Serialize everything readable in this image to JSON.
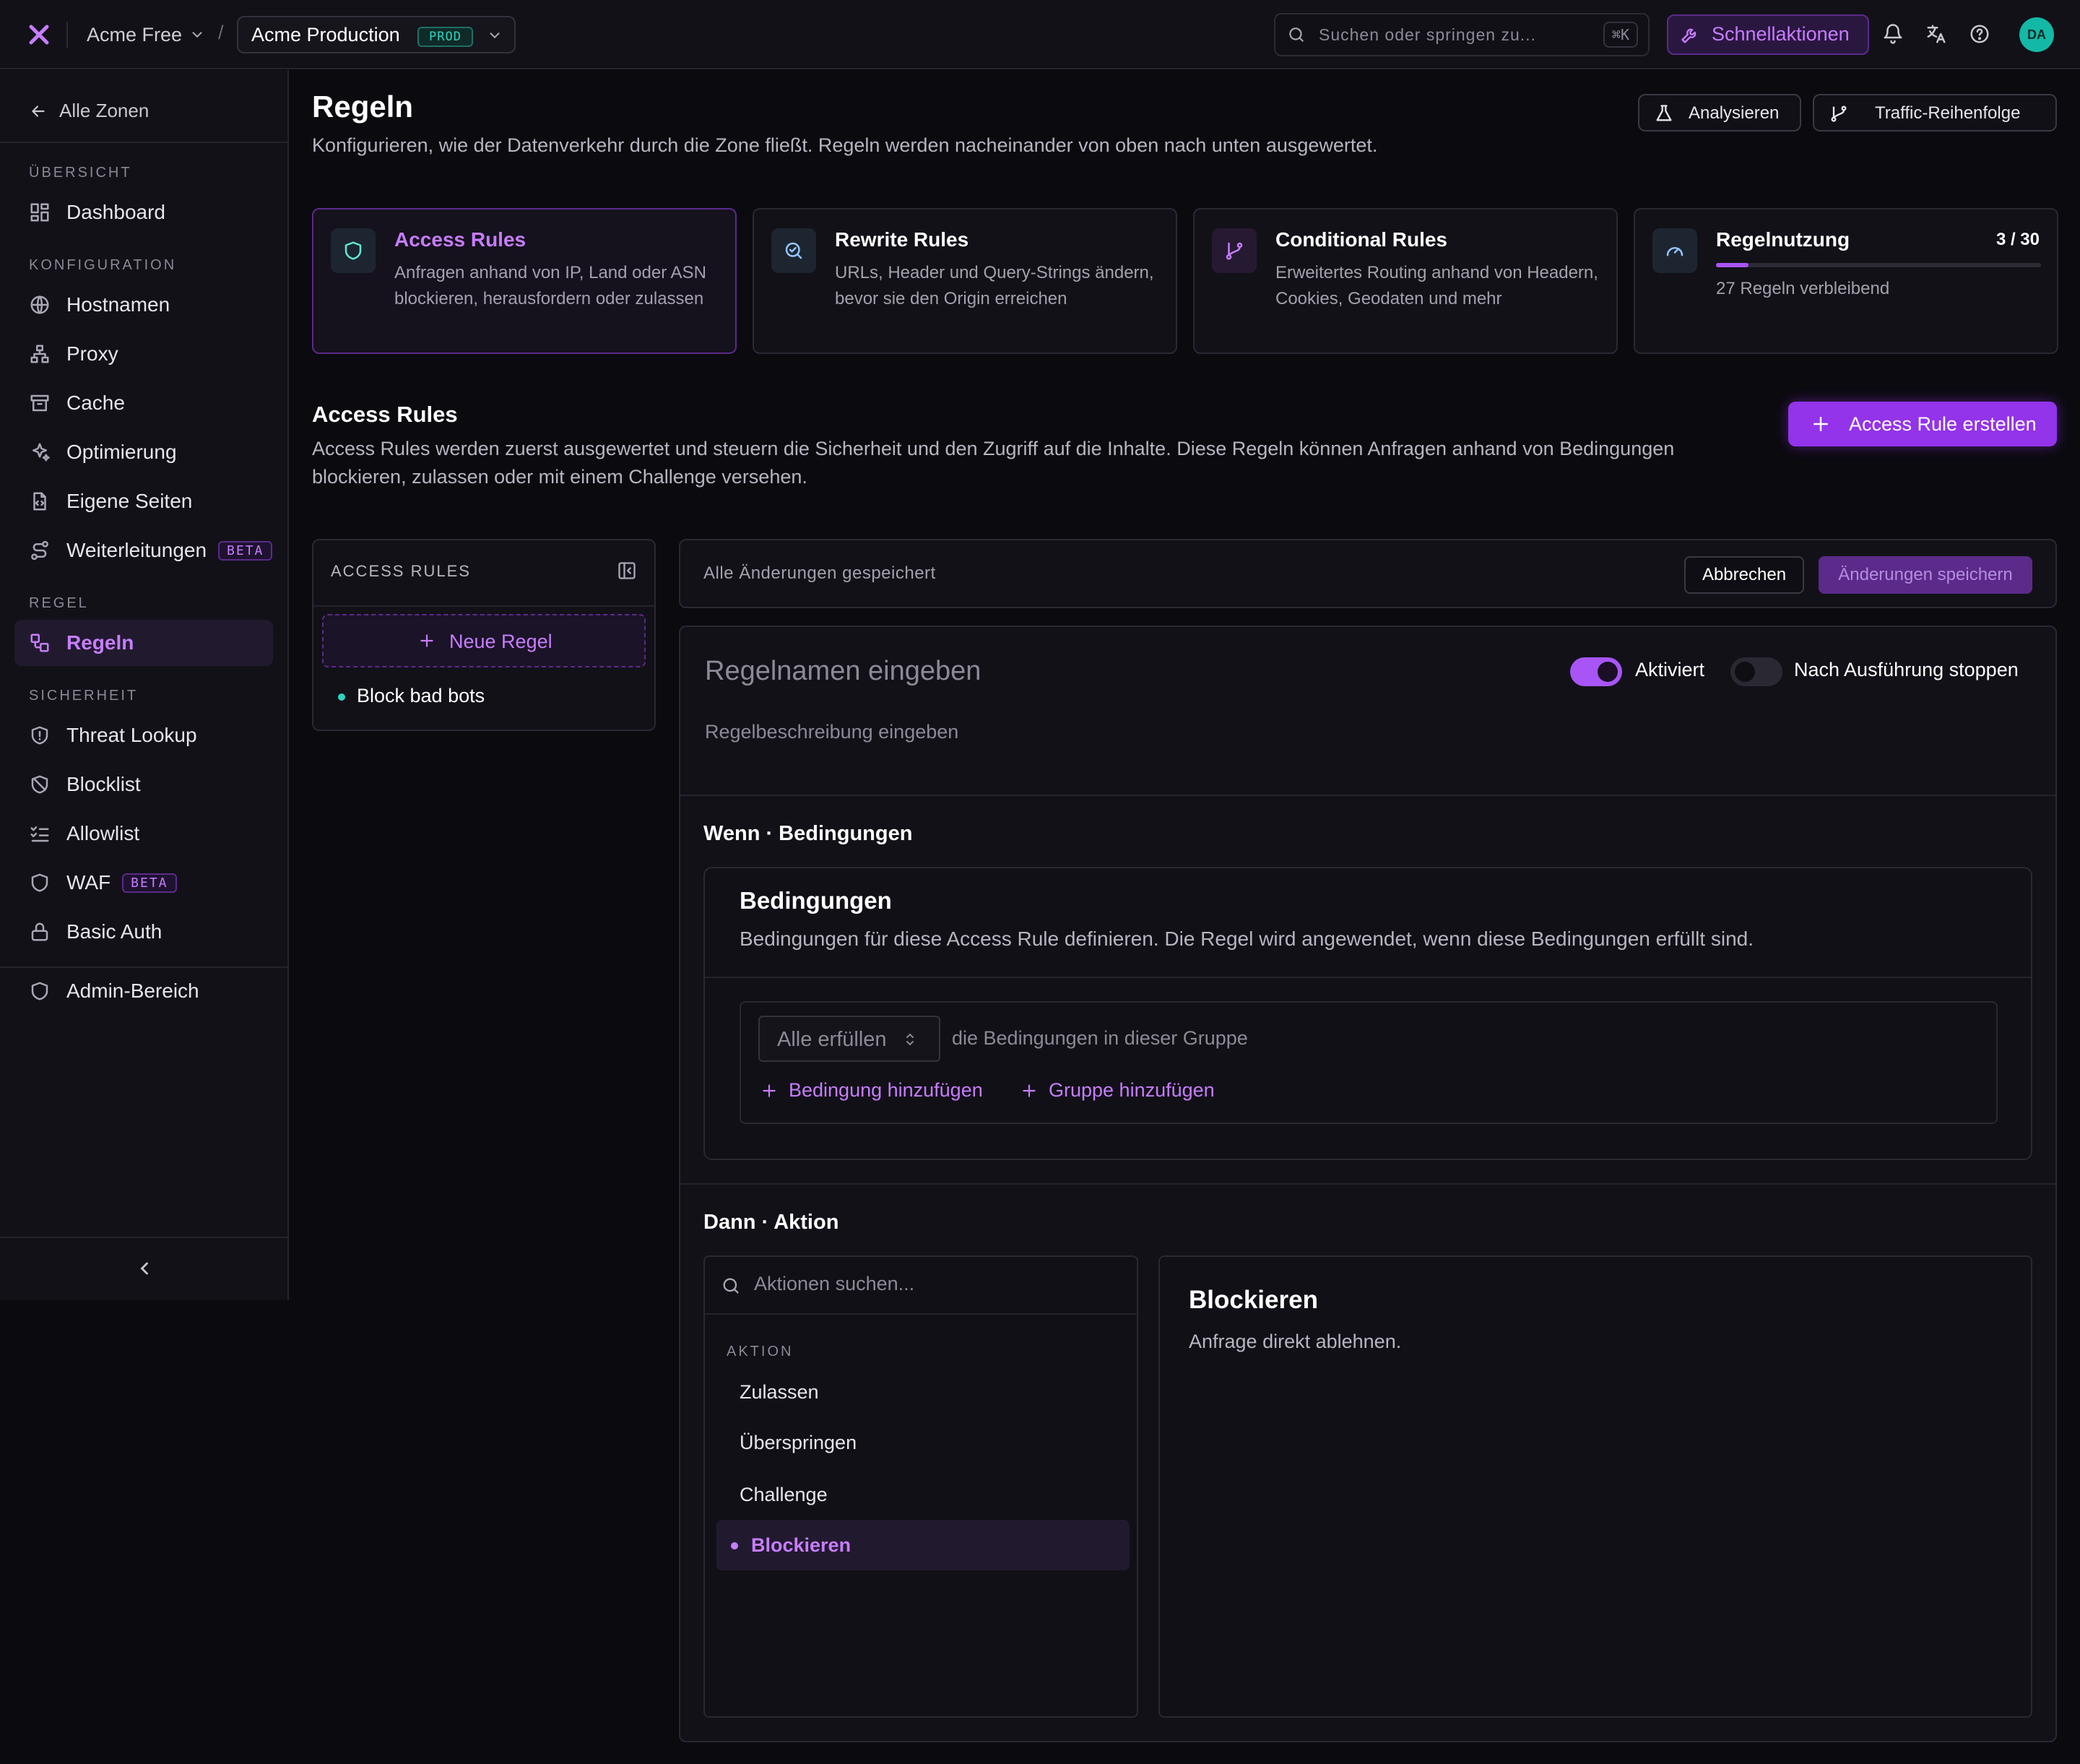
{
  "topbar": {
    "org": "Acme Free",
    "separator": "/",
    "environment": "Acme Production",
    "environment_badge": "PROD",
    "search_placeholder": "Suchen oder springen zu...",
    "search_shortcut": "⌘K",
    "quick_actions": "Schnellaktionen",
    "avatar_initials": "DA"
  },
  "sidebar": {
    "back": "Alle Zonen",
    "sections": {
      "overview": "ÜBERSICHT",
      "config": "KONFIGURATION",
      "rule": "REGEL",
      "security": "SICHERHEIT"
    },
    "items": {
      "dashboard": "Dashboard",
      "hostnames": "Hostnamen",
      "proxy": "Proxy",
      "cache": "Cache",
      "optimization": "Optimierung",
      "custom_pages": "Eigene Seiten",
      "redirects": "Weiterleitungen",
      "redirects_badge": "BETA",
      "rules": "Regeln",
      "threat_lookup": "Threat Lookup",
      "blocklist": "Blocklist",
      "allowlist": "Allowlist",
      "waf": "WAF",
      "waf_badge": "BETA",
      "basic_auth": "Basic Auth",
      "admin": "Admin-Bereich"
    }
  },
  "page": {
    "title": "Regeln",
    "subtitle": "Konfigurieren, wie der Datenverkehr durch die Zone fließt. Regeln werden nacheinander von oben nach unten ausgewertet.",
    "analyze": "Analysieren",
    "traffic_order": "Traffic-Reihenfolge"
  },
  "cards": [
    {
      "title": "Access Rules",
      "desc": "Anfragen anhand von IP, Land oder ASN blockieren, herausfordern oder zulassen"
    },
    {
      "title": "Rewrite Rules",
      "desc": "URLs, Header und Query-Strings ändern, bevor sie den Origin erreichen"
    },
    {
      "title": "Conditional Rules",
      "desc": "Erweitertes Routing anhand von Headern, Cookies, Geodaten und mehr"
    }
  ],
  "usage": {
    "title": "Regelnutzung",
    "count": "3 / 30",
    "ratio": 0.1,
    "remaining": "27 Regeln verbleibend"
  },
  "section": {
    "title": "Access Rules",
    "desc": "Access Rules werden zuerst ausgewertet und steuern die Sicherheit und den Zugriff auf die Inhalte. Diese Regeln können Anfragen anhand von Bedingungen blockieren, zulassen oder mit einem Challenge versehen.",
    "create": "Access Rule erstellen"
  },
  "rules_list": {
    "header": "ACCESS RULES",
    "new_rule": "Neue Regel",
    "items": [
      "Block bad bots"
    ]
  },
  "editor": {
    "status": "Alle Änderungen gespeichert",
    "cancel": "Abbrechen",
    "save": "Änderungen speichern",
    "name_placeholder": "Regelnamen eingeben",
    "desc_placeholder": "Regelbeschreibung eingeben",
    "enabled_label": "Aktiviert",
    "stop_label": "Nach Ausführung stoppen",
    "when_title": "Wenn · Bedingungen",
    "conditions_title": "Bedingungen",
    "conditions_desc": "Bedingungen für diese Access Rule definieren. Die Regel wird angewendet, wenn diese Bedingungen erfüllt sind.",
    "match_select": "Alle erfüllen",
    "match_suffix": "die Bedingungen in dieser Gruppe",
    "add_condition": "Bedingung hinzufügen",
    "add_group": "Gruppe hinzufügen",
    "then_title": "Dann · Aktion",
    "action_search_placeholder": "Aktionen suchen...",
    "action_group": "AKTION",
    "actions": [
      "Zulassen",
      "Überspringen",
      "Challenge",
      "Blockieren"
    ],
    "selected_action_title": "Blockieren",
    "selected_action_desc": "Anfrage direkt ablehnen."
  },
  "colors": {
    "accent": "#a855f7",
    "accent_text": "#c77dff",
    "teal": "#2dd4bf",
    "bg": "#0b0a0f",
    "panel": "#121118"
  }
}
